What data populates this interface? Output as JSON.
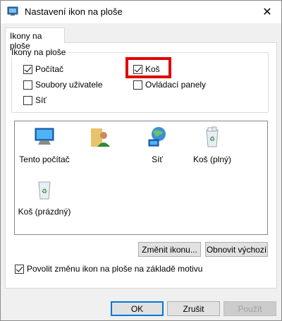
{
  "window": {
    "title": "Nastavení ikon na ploše"
  },
  "tab": {
    "label": "Ikony na ploše"
  },
  "group": {
    "legend": "Ikony na ploše",
    "checkboxes": [
      {
        "label": "Počítač",
        "checked": true
      },
      {
        "label": "Koš",
        "checked": true
      },
      {
        "label": "Soubory uživatele",
        "checked": false
      },
      {
        "label": "Ovládací panely",
        "checked": false
      },
      {
        "label": "Síť",
        "checked": false
      }
    ]
  },
  "icons": [
    {
      "label": "Tento počítač",
      "icon": "computer-icon"
    },
    {
      "label": "",
      "icon": "user-folder-icon"
    },
    {
      "label": "Síť",
      "icon": "network-icon"
    },
    {
      "label": "Koš (plný)",
      "icon": "recycle-bin-full-icon"
    },
    {
      "label": "Koš (prázdný)",
      "icon": "recycle-bin-empty-icon"
    }
  ],
  "buttons": {
    "change_icon": "Změnit ikonu...",
    "restore_default": "Obnovit výchozí",
    "ok": "OK",
    "cancel": "Zrušit",
    "apply": "Použít"
  },
  "theme_option": {
    "label": "Povolit změnu ikon na ploše na základě motivu",
    "checked": true
  },
  "colors": {
    "highlight": "#e00000",
    "accent": "#0078d7"
  }
}
